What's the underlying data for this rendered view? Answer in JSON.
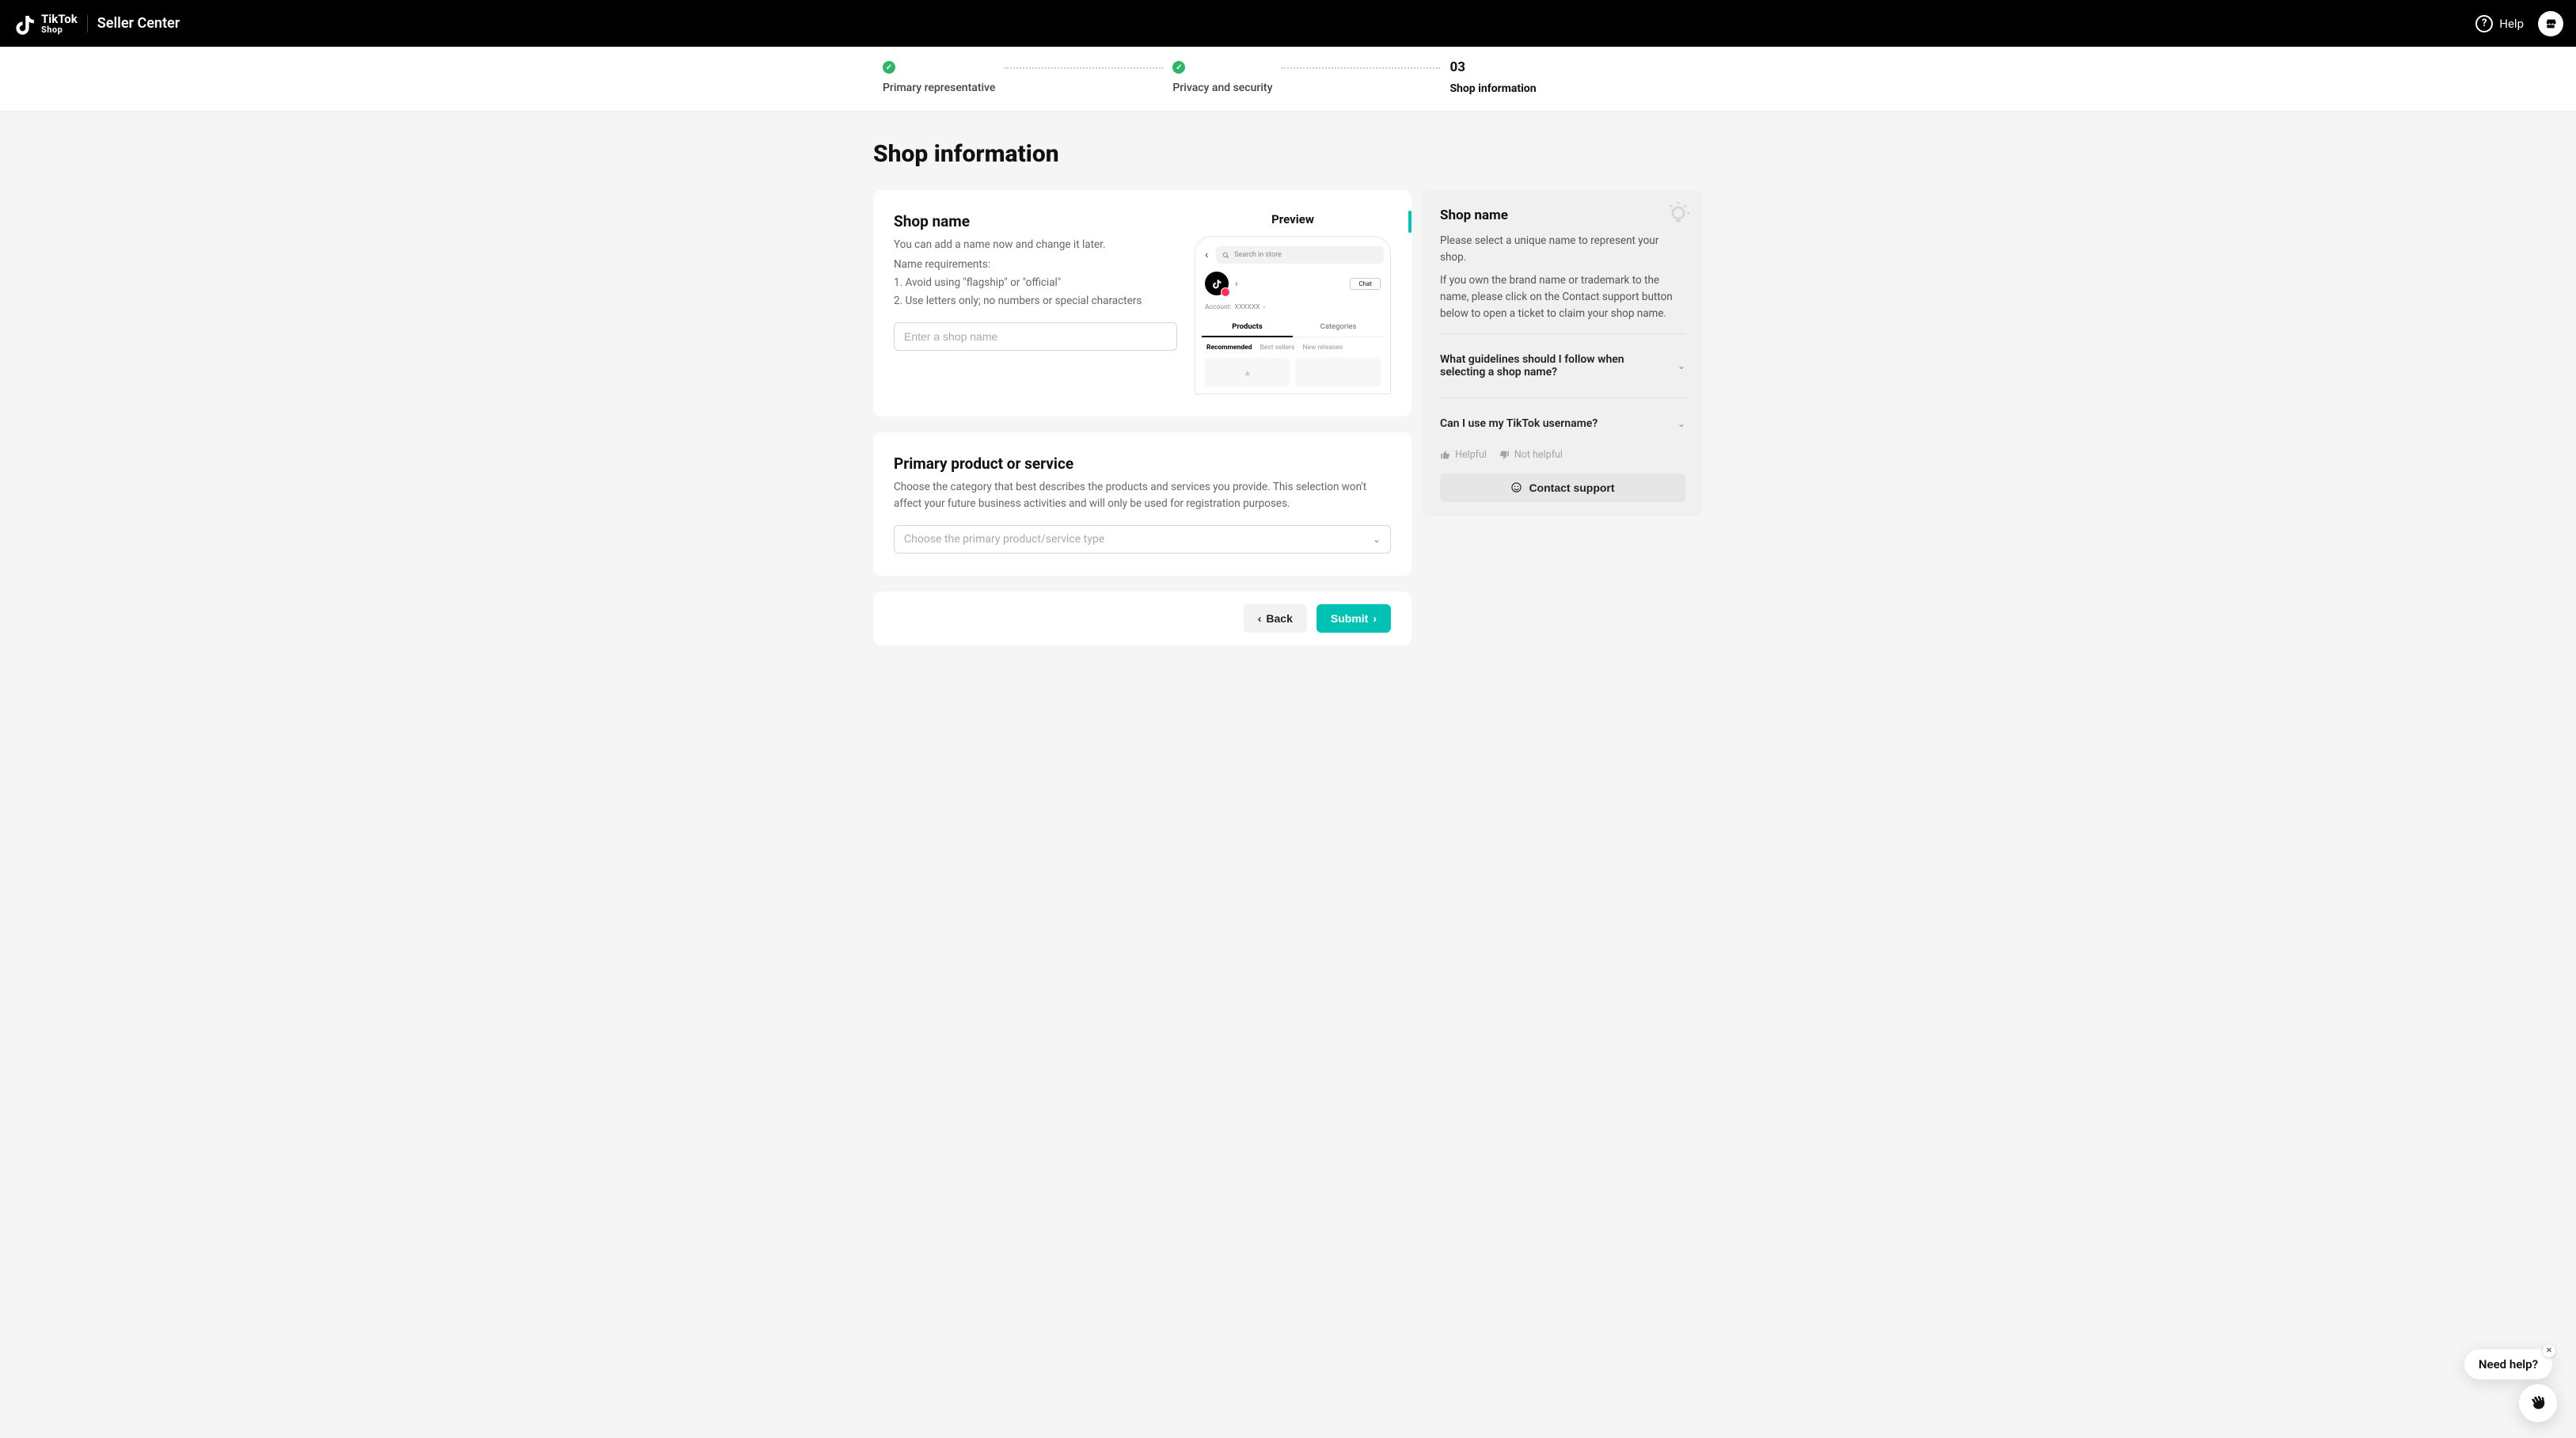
{
  "header": {
    "logo_top": "TikTok",
    "logo_bot": "Shop",
    "title": "Seller Center",
    "help": "Help"
  },
  "steps": {
    "s1": "Primary representative",
    "s2": "Privacy and security",
    "s3_num": "03",
    "s3": "Shop information"
  },
  "page": {
    "title": "Shop information"
  },
  "shopName": {
    "title": "Shop name",
    "desc1": "You can add a name now and change it later.",
    "desc2": "Name requirements:",
    "req1": "1. Avoid using \"flagship\" or \"official\"",
    "req2": "2. Use letters only; no numbers or special characters",
    "placeholder": "Enter a shop name",
    "preview": "Preview"
  },
  "phone": {
    "search": "Search in store",
    "chat": "Chat",
    "account_label": "Account:",
    "account_val": "XXXXXX",
    "tab1": "Products",
    "tab2": "Categories",
    "sub1": "Recommended",
    "sub2": "Best sellers",
    "sub3": "New releases"
  },
  "primary": {
    "title": "Primary product or service",
    "desc": "Choose the category that best describes the products and services you provide. This selection won't affect your future business activities and will only be used for registration purposes.",
    "placeholder": "Choose the primary product/service type"
  },
  "side": {
    "title": "Shop name",
    "p1": "Please select a unique name to represent your shop.",
    "p2": "If you own the brand name or trademark to the name, please click on the Contact support button below to open a ticket to claim your shop name.",
    "faq1": "What guidelines should I follow when selecting a shop name?",
    "faq2": "Can I use my TikTok username?",
    "helpful": "Helpful",
    "not_helpful": "Not helpful",
    "contact": "Contact support"
  },
  "footer": {
    "back": "Back",
    "submit": "Submit"
  },
  "bubble": {
    "text": "Need help?"
  }
}
